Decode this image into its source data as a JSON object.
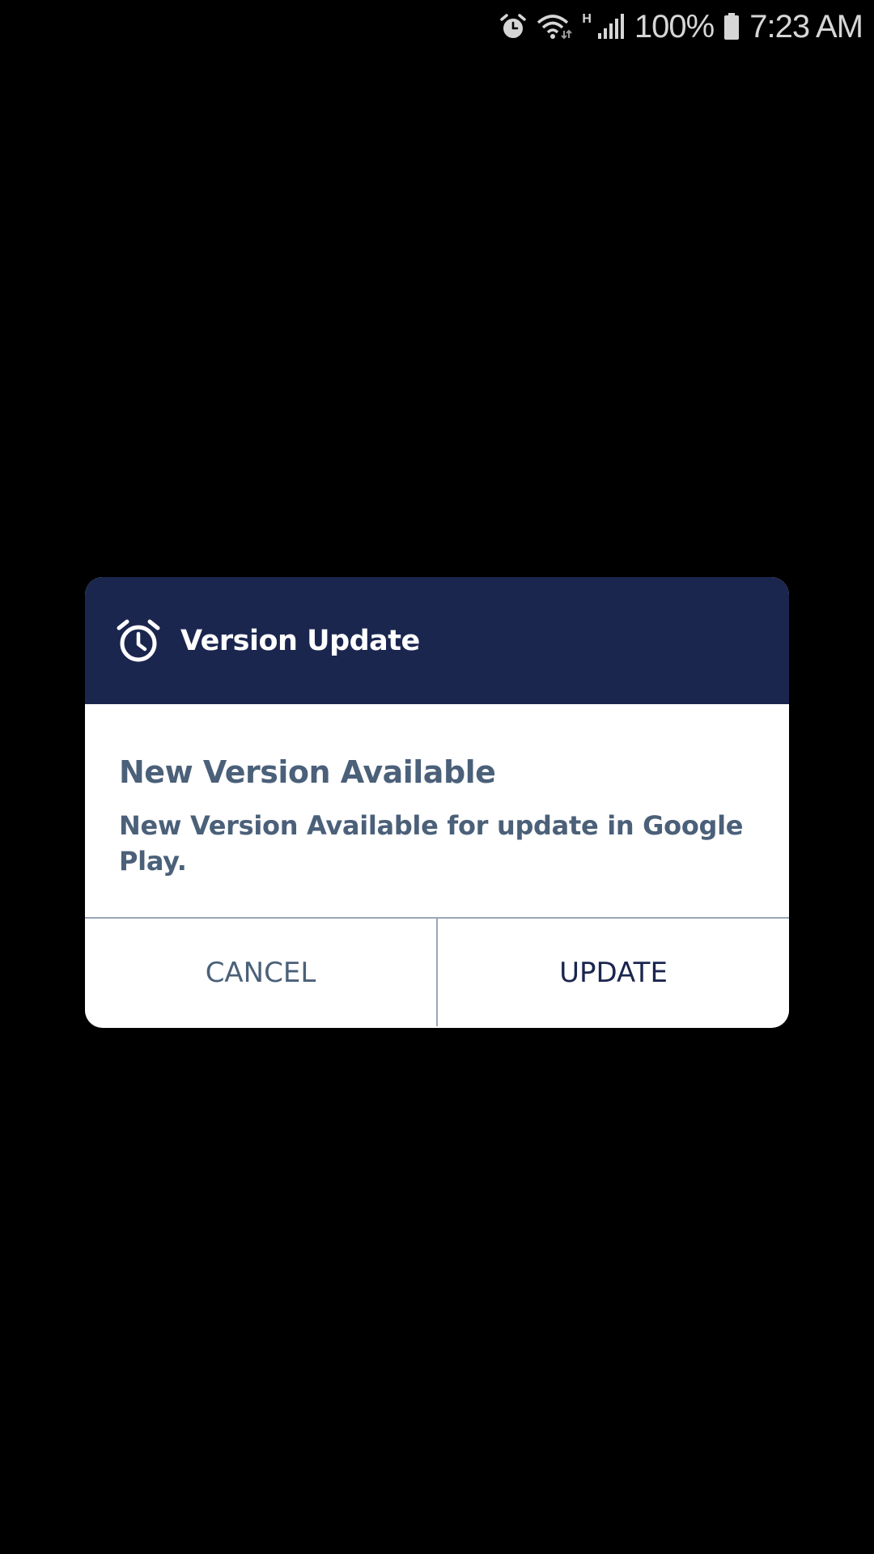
{
  "status_bar": {
    "icons": [
      "alarm-icon",
      "wifi-icon",
      "signal-icon",
      "battery-icon"
    ],
    "network_type": "H",
    "battery_percent": "100%",
    "time": "7:23 AM"
  },
  "dialog": {
    "header_icon": "alarm-clock-icon",
    "title": "Version Update",
    "message_title": "New Version Available",
    "message_text": "New Version Available for update in Google Play.",
    "cancel_label": "CANCEL",
    "update_label": "UPDATE"
  },
  "colors": {
    "background": "#000000",
    "header": "#1b264f",
    "body_text": "#4b6079",
    "primary_action": "#1b264f",
    "divider": "#9aa6b7"
  }
}
